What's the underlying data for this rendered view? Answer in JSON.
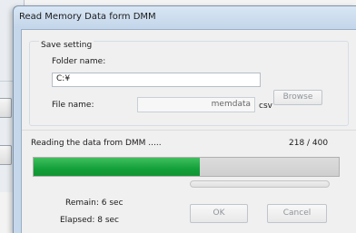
{
  "dialog": {
    "title": "Read Memory Data form DMM"
  },
  "save_setting": {
    "group_label": "Save setting",
    "folder_label": "Folder name:",
    "folder_value": "C:¥",
    "browse_label": "Browse",
    "file_label": "File name:",
    "file_value": "memdata",
    "file_ext": "csv"
  },
  "progress": {
    "status_text": "Reading the data from DMM .....",
    "count_text": "218 / 400",
    "current": 218,
    "total": 400,
    "color": "#14a03b",
    "remain_text": "Remain: 6 sec",
    "elapsed_text": "Elapsed: 8 sec"
  },
  "buttons": {
    "ok_label": "OK",
    "cancel_label": "Cancel"
  }
}
